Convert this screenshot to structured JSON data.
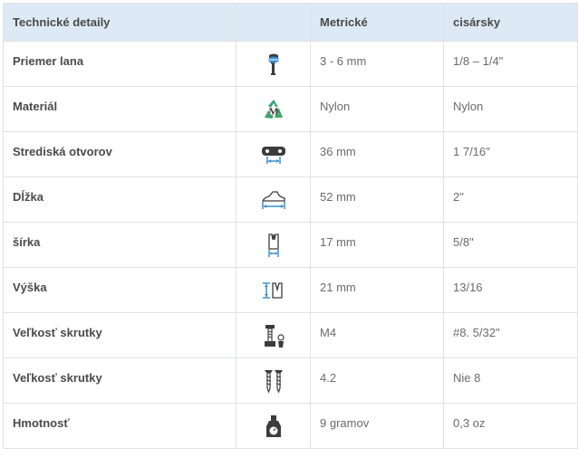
{
  "headers": [
    "Technické detaily",
    "",
    "Metrické",
    "cisársky"
  ],
  "rows": [
    {
      "label": "Priemer lana",
      "icon": "rope-diameter-icon",
      "metric": "3 - 6 mm",
      "imperial": "1/8 – 1/4\""
    },
    {
      "label": "Materiál",
      "icon": "recycle-material-icon",
      "metric": "Nylon",
      "imperial": "Nylon"
    },
    {
      "label": "Strediská otvorov",
      "icon": "hole-spacing-icon",
      "metric": "36 mm",
      "imperial": "1 7/16\""
    },
    {
      "label": "Dĺžka",
      "icon": "length-icon",
      "metric": "52 mm",
      "imperial": "2\""
    },
    {
      "label": "šírka",
      "icon": "width-icon",
      "metric": "17 mm",
      "imperial": "5/8\""
    },
    {
      "label": "Výška",
      "icon": "height-icon",
      "metric": "21 mm",
      "imperial": "13/16"
    },
    {
      "label": "Veľkosť skrutky",
      "icon": "bolt-nut-icon",
      "metric": "M4",
      "imperial": "#8. 5/32\""
    },
    {
      "label": "Veľkosť skrutky",
      "icon": "screws-icon",
      "metric": "4.2",
      "imperial": "Nie 8"
    },
    {
      "label": "Hmotnosť",
      "icon": "weight-icon",
      "metric": "9 gramov",
      "imperial": "0,3 oz"
    }
  ],
  "colors": {
    "header_bg": "#dde9f4",
    "border": "#dfe2e5",
    "icon_blue": "#3a8fd0",
    "icon_dark": "#3c3c3c",
    "recycle_green": "#3aa56b"
  }
}
